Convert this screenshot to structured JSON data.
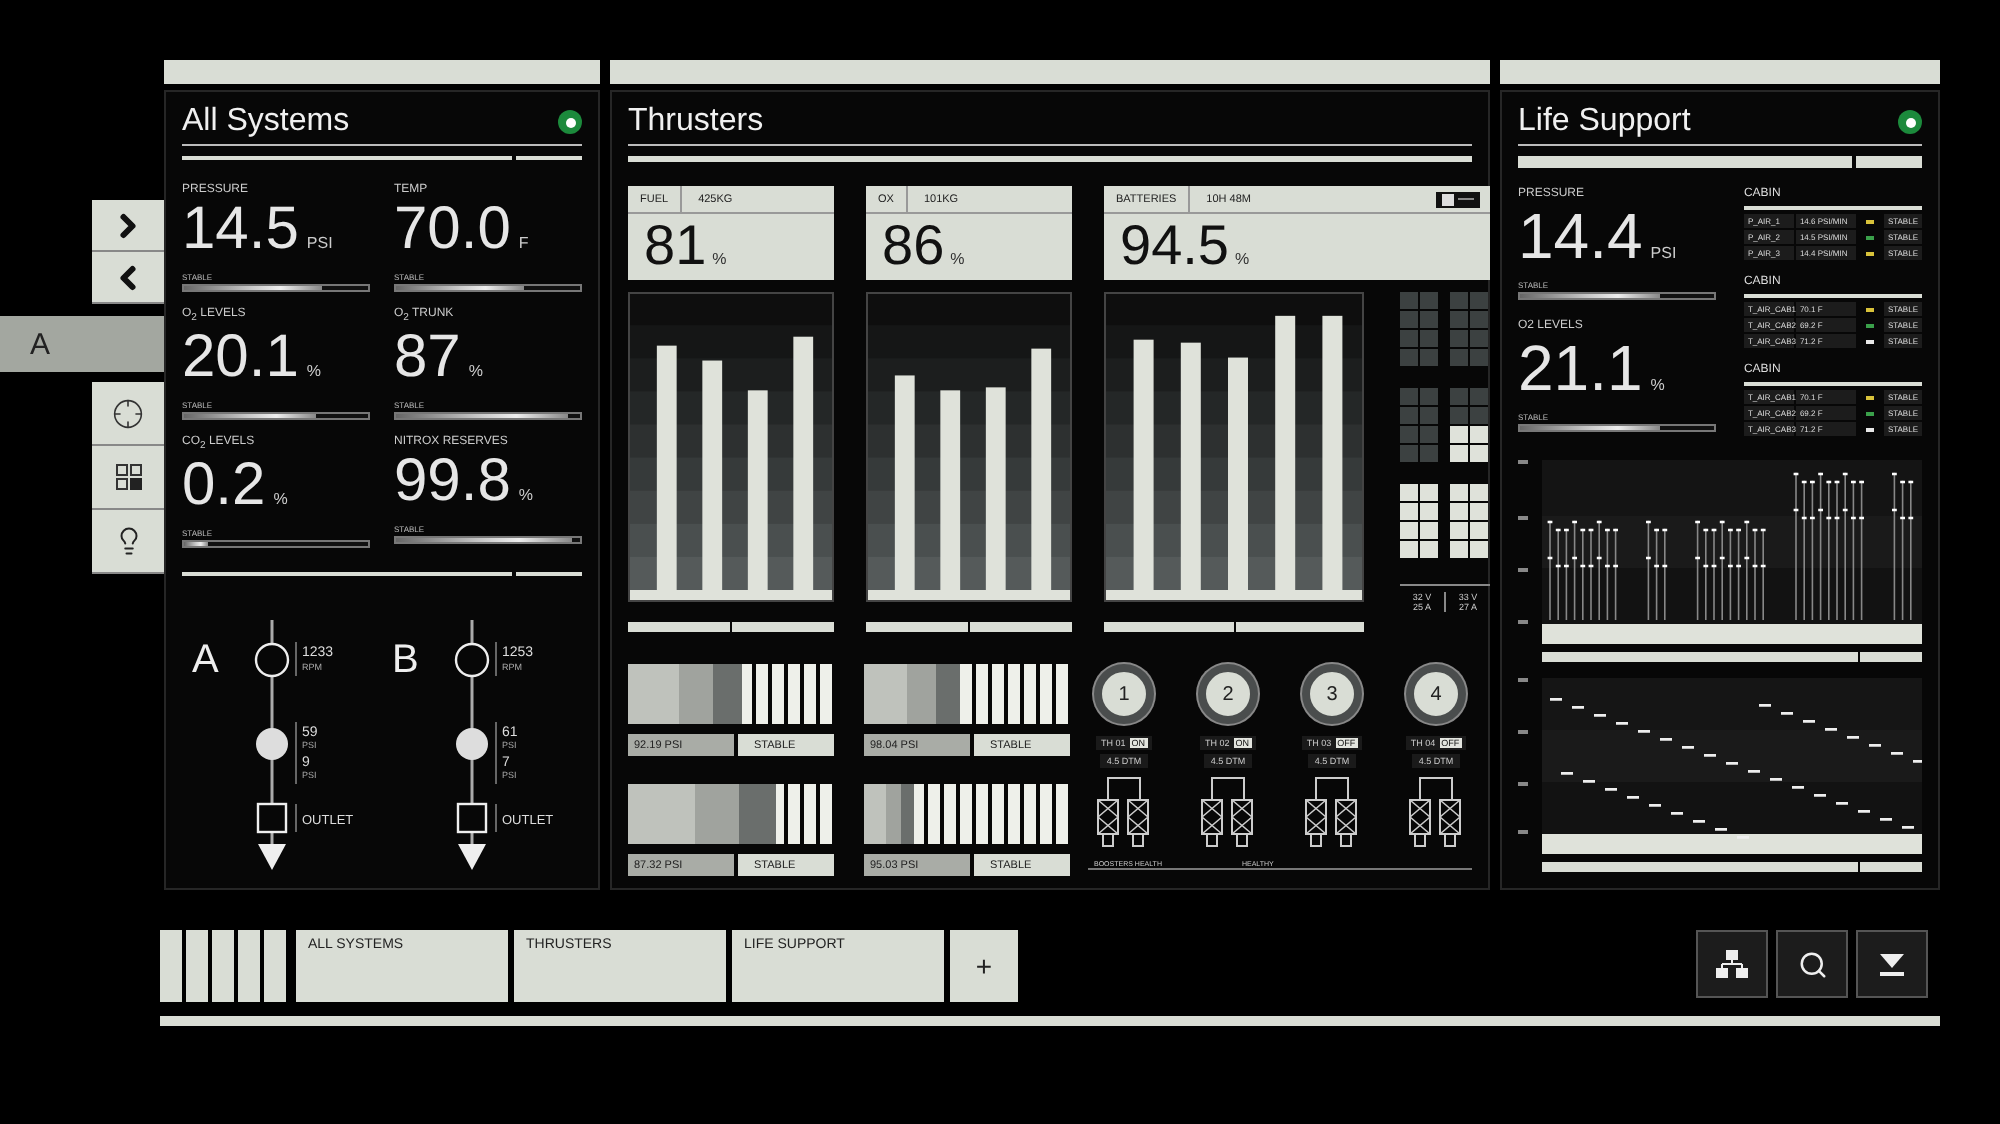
{
  "side_nav": {
    "tab": {
      "label": "A",
      "selected": true
    }
  },
  "all_systems": {
    "title": "All Systems",
    "online": true,
    "metrics": [
      {
        "label": "PRESSURE",
        "value": "14.5",
        "unit": "PSI",
        "status": "STABLE",
        "level": 0.75
      },
      {
        "label": "TEMP",
        "value": "70.0",
        "unit": "F",
        "status": "STABLE",
        "level": 0.7
      },
      {
        "label": "O$_{2}$ LEVELS",
        "value": "20.1",
        "unit": "%",
        "status": "STABLE",
        "level": 0.72
      },
      {
        "label": "O$_{2}$ TRUNK",
        "value": "87",
        "unit": "%",
        "status": "STABLE",
        "level": 0.94
      },
      {
        "label": "CO$_{2}$ LEVELS",
        "value": "0.2",
        "unit": "%",
        "status": "STABLE",
        "level": 0.13
      },
      {
        "label": "NITROX RESERVES",
        "value": "99.8",
        "unit": "%",
        "status": "STABLE",
        "level": 0.96
      }
    ],
    "pumps": [
      {
        "name": "A",
        "readings": [
          {
            "value": "1233",
            "unit": "RPM"
          },
          {
            "value": "59",
            "unit": "PSI"
          },
          {
            "value": "9",
            "unit": "PSI"
          }
        ],
        "outlet": "OUTLET"
      },
      {
        "name": "B",
        "readings": [
          {
            "value": "1253",
            "unit": "RPM"
          },
          {
            "value": "61",
            "unit": "PSI"
          },
          {
            "value": "7",
            "unit": "PSI"
          }
        ],
        "outlet": "OUTLET"
      }
    ]
  },
  "thrusters": {
    "title": "Thrusters",
    "tanks": [
      {
        "label": "FUEL",
        "amount": "425KG",
        "value": "81",
        "unit": "%"
      },
      {
        "label": "OX",
        "amount": "101KG",
        "value": "86",
        "unit": "%"
      },
      {
        "label": "BATTERIES",
        "amount": "10H 48M",
        "value": "94.5",
        "unit": "%"
      }
    ],
    "cell_readings": [
      {
        "volts": "32 V",
        "amps": "25 A"
      },
      {
        "volts": "33 V",
        "amps": "27 A"
      }
    ],
    "gauges": [
      {
        "reading": "92.19 PSI",
        "status": "STABLE",
        "level": 0.55
      },
      {
        "reading": "98.04 PSI",
        "status": "STABLE",
        "level": 0.47
      },
      {
        "reading": "87.32 PSI",
        "status": "STABLE",
        "level": 0.72
      },
      {
        "reading": "95.03 PSI",
        "status": "STABLE",
        "level": 0.24
      }
    ],
    "boosters": [
      {
        "number": "1",
        "label": "TH 01",
        "status": "ON",
        "dtm": "4.5 DTM"
      },
      {
        "number": "2",
        "label": "TH 02",
        "status": "ON",
        "dtm": "4.5 DTM"
      },
      {
        "number": "3",
        "label": "TH 03",
        "status": "OFF",
        "dtm": "4.5 DTM"
      },
      {
        "number": "4",
        "label": "TH 04",
        "status": "OFF",
        "dtm": "4.5 DTM"
      }
    ],
    "health": {
      "label": "BOOSTERS HEALTH",
      "value": "HEALTHY"
    }
  },
  "life_support": {
    "title": "Life Support",
    "online": true,
    "metrics": [
      {
        "label": "PRESSURE",
        "value": "14.4",
        "unit": "PSI",
        "status": "STABLE",
        "level": 0.72
      },
      {
        "label": "O2 LEVELS",
        "value": "21.1",
        "unit": "%",
        "status": "STABLE",
        "level": 0.72
      }
    ],
    "cabins": [
      {
        "title": "CABIN",
        "rows": [
          {
            "name": "P_AIR_1",
            "value": "14.6 PSI/MIN",
            "color": "#d8c23a",
            "status": "STABLE"
          },
          {
            "name": "P_AIR_2",
            "value": "14.5 PSI/MIN",
            "color": "#3aa04a",
            "status": "STABLE"
          },
          {
            "name": "P_AIR_3",
            "value": "14.4 PSI/MIN",
            "color": "#d8c23a",
            "status": "STABLE"
          }
        ]
      },
      {
        "title": "CABIN",
        "rows": [
          {
            "name": "T_AIR_CAB1",
            "value": "70.1 F",
            "color": "#d8c23a",
            "status": "STABLE"
          },
          {
            "name": "T_AIR_CAB2",
            "value": "69.2 F",
            "color": "#3aa04a",
            "status": "STABLE"
          },
          {
            "name": "T_AIR_CAB3",
            "value": "71.2 F",
            "color": "#e8e8e8",
            "status": "STABLE"
          }
        ]
      },
      {
        "title": "CABIN",
        "rows": [
          {
            "name": "T_AIR_CAB1",
            "value": "70.1 F",
            "color": "#d8c23a",
            "status": "STABLE"
          },
          {
            "name": "T_AIR_CAB2",
            "value": "69.2 F",
            "color": "#3aa04a",
            "status": "STABLE"
          },
          {
            "name": "T_AIR_CAB3",
            "value": "71.2 F",
            "color": "#e8e8e8",
            "status": "STABLE"
          }
        ]
      }
    ]
  },
  "tabs": [
    "ALL SYSTEMS",
    "THRUSTERS",
    "LIFE SUPPORT"
  ],
  "add_tab": "+"
}
